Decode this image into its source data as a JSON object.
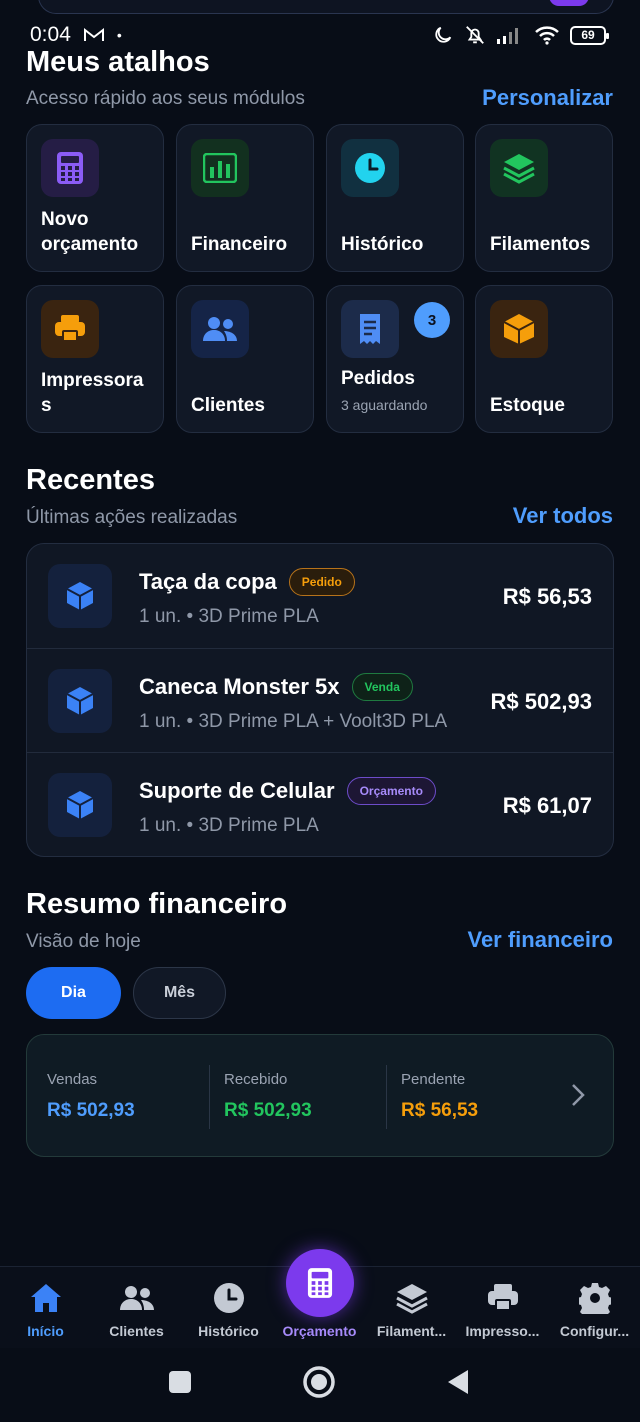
{
  "status_bar": {
    "time": "0:04",
    "battery": "69"
  },
  "shortcuts": {
    "title": "Meus atalhos",
    "subtitle": "Acesso rápido aos seus módulos",
    "action": "Personalizar",
    "tiles": [
      {
        "label": "Novo orçamento",
        "icon": "calculator-icon"
      },
      {
        "label": "Financeiro",
        "icon": "bar-chart-icon"
      },
      {
        "label": "Histórico",
        "icon": "clock-icon"
      },
      {
        "label": "Filamentos",
        "icon": "layers-icon"
      },
      {
        "label": "Impressoras",
        "icon": "printer-icon"
      },
      {
        "label": "Clientes",
        "icon": "users-icon"
      },
      {
        "label": "Pedidos",
        "sub": "3 aguardando",
        "badge": "3",
        "icon": "receipt-icon"
      },
      {
        "label": "Estoque",
        "icon": "box-icon"
      }
    ]
  },
  "recents": {
    "title": "Recentes",
    "subtitle": "Últimas ações realizadas",
    "action": "Ver todos",
    "items": [
      {
        "name": "Taça da copa",
        "tag": "Pedido",
        "meta": "1 un. • 3D Prime PLA",
        "price": "R$ 56,53"
      },
      {
        "name": "Caneca Monster 5x",
        "tag": "Venda",
        "meta": "1 un. • 3D Prime PLA + Voolt3D PLA",
        "price": "R$ 502,93"
      },
      {
        "name": "Suporte de Celular",
        "tag": "Orçamento",
        "meta": "1 un. • 3D Prime PLA",
        "price": "R$ 61,07"
      }
    ]
  },
  "finance": {
    "title": "Resumo financeiro",
    "subtitle": "Visão de hoje",
    "action": "Ver financeiro",
    "toggle": {
      "day": "Dia",
      "month": "Mês",
      "selected": "Dia"
    },
    "stats": [
      {
        "label": "Vendas",
        "value": "R$ 502,93",
        "color": "#4f9dfd"
      },
      {
        "label": "Recebido",
        "value": "R$ 502,93",
        "color": "#22c55e"
      },
      {
        "label": "Pendente",
        "value": "R$ 56,53",
        "color": "#f59e0b"
      }
    ]
  },
  "bottom_nav": [
    {
      "label": "Início",
      "icon": "home-icon",
      "active": true
    },
    {
      "label": "Clientes",
      "icon": "users-icon"
    },
    {
      "label": "Histórico",
      "icon": "clock-icon"
    },
    {
      "label": "Orçamento",
      "icon": "calculator-icon"
    },
    {
      "label": "Filament...",
      "icon": "layers-icon"
    },
    {
      "label": "Impresso...",
      "icon": "printer-icon"
    },
    {
      "label": "Configur...",
      "icon": "gear-icon"
    }
  ]
}
